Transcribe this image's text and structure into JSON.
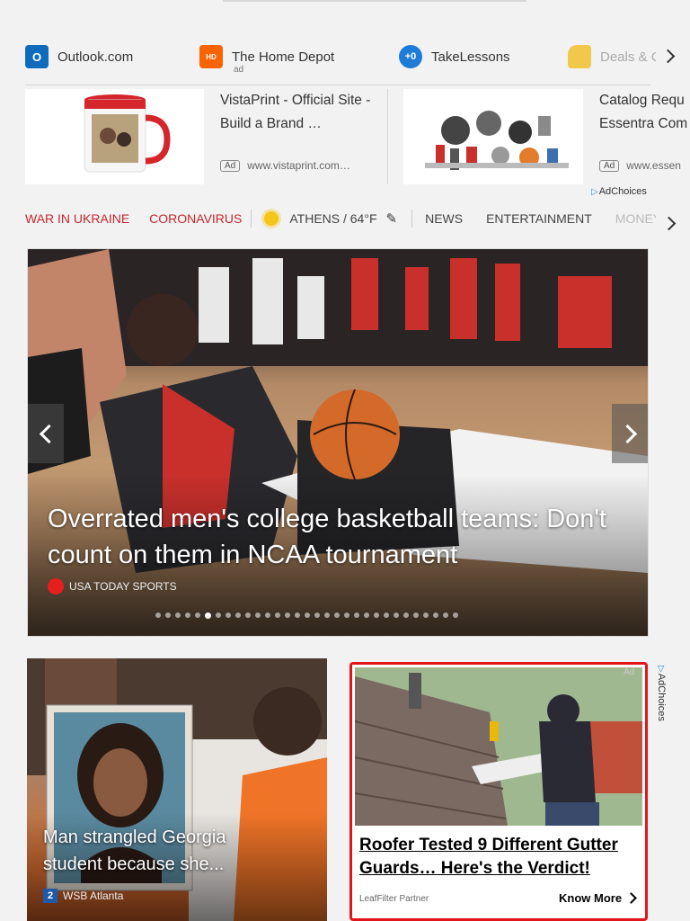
{
  "quick_links": [
    {
      "label": "Outlook.com",
      "icon": "outlook-icon",
      "color": "#0f6cbd"
    },
    {
      "label": "The Home Depot",
      "sub": "ad",
      "icon": "home-depot-icon",
      "color": "#f96302"
    },
    {
      "label": "TakeLessons",
      "icon": "takelessons-icon",
      "color": "#1e7bd8"
    },
    {
      "label": "Deals & C",
      "icon": "deals-tag-icon",
      "color": "#f2c84b"
    }
  ],
  "ads": [
    {
      "title": "VistaPrint - Official Site - Build a Brand …",
      "badge": "Ad",
      "url": "www.vistaprint.com…",
      "image": "mug-image"
    },
    {
      "title": "Catalog Requ Essentra Com",
      "badge": "Ad",
      "url": "www.essen",
      "image": "parts-image"
    }
  ],
  "adchoices_label": "AdChoices",
  "nav": {
    "war": "WAR IN UKRAINE",
    "corona": "CORONAVIRUS",
    "weather": "ATHENS / 64°F",
    "news": "NEWS",
    "entertainment": "ENTERTAINMENT",
    "money": "MONEY"
  },
  "hero": {
    "title": "Overrated men's college basketball teams: Don't count on them in NCAA tournament",
    "source": "USA TODAY SPORTS",
    "slide_count": 31,
    "active_slide": 5
  },
  "cards": {
    "news": {
      "title": "Man strangled Georgia student because she...",
      "source": "WSB Atlanta"
    },
    "promo": {
      "title": "Roofer Tested 9 Different Gutter Guards… Here's the Verdict!",
      "sponsor": "LeafFilter Partner",
      "cta": "Know More",
      "ad_label": "Ad",
      "adchoices": "AdChoices"
    }
  },
  "colors": {
    "accent_red": "#c4262e",
    "promo_border": "#e0161b"
  }
}
